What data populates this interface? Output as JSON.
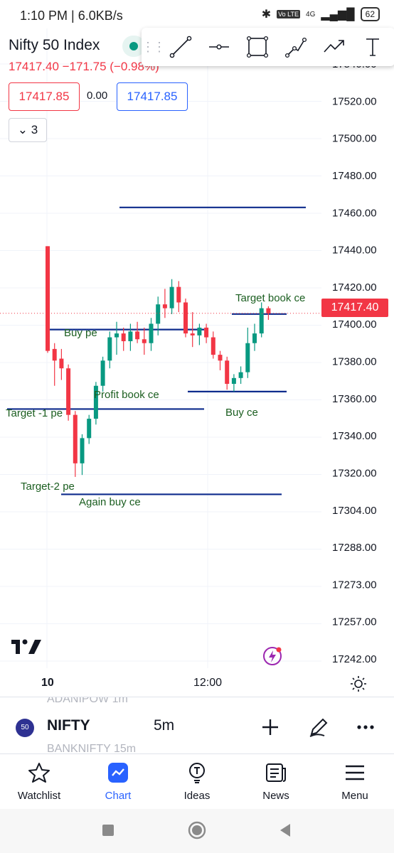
{
  "status_bar": {
    "time_speed": "1:10 PM | 6.0KB/s",
    "volte": "Vo LTE",
    "network": "4G",
    "battery": "62"
  },
  "header": {
    "title": "Nifty 50 Index",
    "price_change": "17417.40  −171.75 (−0.98%)",
    "sell_price": "17417.85",
    "spread": "0.00",
    "buy_price": "17417.85",
    "collapse_count": "3"
  },
  "drawing_toolbar": {
    "tools": [
      "trend-line-tool",
      "horizontal-line-tool",
      "rectangle-tool",
      "path-tool",
      "arrow-tool",
      "text-tool"
    ]
  },
  "chart": {
    "last_price_label": "17417.40",
    "price_axis": [
      "17540.00",
      "17520.00",
      "17500.00",
      "17480.00",
      "17460.00",
      "17440.00",
      "17420.00",
      "17400.00",
      "17380.00",
      "17360.00",
      "17340.00",
      "17320.00",
      "17304.00",
      "17288.00",
      "17273.00",
      "17257.00",
      "17242.00"
    ],
    "time_axis": [
      "10",
      "12:00"
    ],
    "annotations": [
      "Target book ce",
      "Buy pe",
      "Profit book ce",
      "Buy ce",
      "Target -1 pe",
      "Target-2 pe",
      "Again buy ce"
    ]
  },
  "chart_data": {
    "type": "candlestick",
    "timeframe": "5m",
    "up_color": "#089981",
    "down_color": "#f23645",
    "ohlc": [
      [
        17452,
        17452,
        17397,
        17398
      ],
      [
        17399,
        17402,
        17380,
        17393
      ],
      [
        17394,
        17399,
        17383,
        17389
      ],
      [
        17389,
        17391,
        17362,
        17365
      ],
      [
        17365,
        17367,
        17333,
        17340
      ],
      [
        17340,
        17355,
        17334,
        17353
      ],
      [
        17353,
        17365,
        17350,
        17363
      ],
      [
        17363,
        17382,
        17360,
        17380
      ],
      [
        17380,
        17395,
        17377,
        17393
      ],
      [
        17393,
        17408,
        17389,
        17405
      ],
      [
        17405,
        17413,
        17396,
        17407
      ],
      [
        17407,
        17410,
        17398,
        17403
      ],
      [
        17403,
        17412,
        17398,
        17408
      ],
      [
        17408,
        17413,
        17402,
        17404
      ],
      [
        17404,
        17410,
        17396,
        17402
      ],
      [
        17402,
        17415,
        17398,
        17412
      ],
      [
        17412,
        17426,
        17406,
        17422
      ],
      [
        17422,
        17430,
        17415,
        17420
      ],
      [
        17420,
        17435,
        17417,
        17431
      ],
      [
        17431,
        17434,
        17418,
        17423
      ],
      [
        17423,
        17425,
        17405,
        17407
      ],
      [
        17407,
        17418,
        17400,
        17406
      ],
      [
        17406,
        17412,
        17401,
        17410
      ],
      [
        17410,
        17412,
        17402,
        17405
      ],
      [
        17405,
        17408,
        17394,
        17396
      ],
      [
        17396,
        17398,
        17388,
        17393
      ],
      [
        17393,
        17395,
        17378,
        17381
      ],
      [
        17381,
        17386,
        17377,
        17384
      ],
      [
        17384,
        17390,
        17381,
        17387
      ],
      [
        17387,
        17410,
        17384,
        17402
      ],
      [
        17402,
        17412,
        17398,
        17407
      ],
      [
        17407,
        17423,
        17405,
        17420
      ],
      [
        17420,
        17421,
        17414,
        17417.4
      ]
    ],
    "horizontal_lines": [
      17472,
      17409,
      17377,
      17368,
      17324,
      17417
    ],
    "ylim": [
      17238,
      17546
    ]
  },
  "toolbar_bottom": {
    "ghost_top": "ADANIPOW   1m",
    "symbol_badge": "50",
    "symbol": "NIFTY",
    "interval": "5m",
    "ghost_bottom": "BANKNIFTY   15m"
  },
  "nav": {
    "watchlist": "Watchlist",
    "chart": "Chart",
    "ideas": "Ideas",
    "news": "News",
    "menu": "Menu"
  },
  "colors": {
    "accent": "#2962ff",
    "down": "#f23645",
    "up": "#089981",
    "drawing_line": "#0d2b8c",
    "annotation_text": "#1b5e20"
  }
}
